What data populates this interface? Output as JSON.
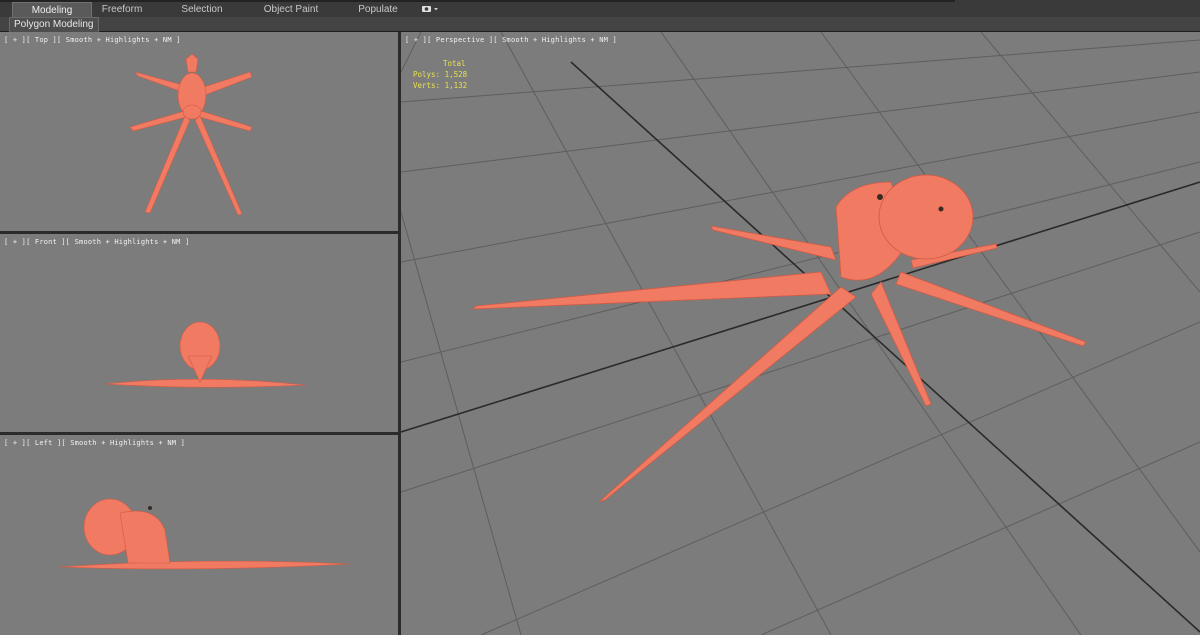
{
  "ribbon": {
    "tabs": [
      {
        "label": "Modeling",
        "active": true
      },
      {
        "label": "Freeform",
        "active": false
      },
      {
        "label": "Selection",
        "active": false
      },
      {
        "label": "Object Paint",
        "active": false
      },
      {
        "label": "Populate",
        "active": false
      }
    ],
    "extra_icon": "camera-dropdown-icon",
    "sub_tab": "Polygon Modeling"
  },
  "viewports": {
    "top": {
      "label": "[ + ][ Top ][ Smooth + Highlights + NM ]"
    },
    "front": {
      "label": "[ + ][ Front ][ Smooth + Highlights + NM ]"
    },
    "left": {
      "label": "[ + ][ Left ][ Smooth + Highlights + NM ]"
    },
    "perspective": {
      "label": "[ + ][ Perspective ][ Smooth + Highlights + NM ]",
      "stats": {
        "title": "Total",
        "polys": "Polys: 1,528",
        "verts": "Verts: 1,132"
      }
    }
  },
  "colors": {
    "viewport_bg": "#7c7c7c",
    "model": "#f07a62",
    "grid": "#3a3a3a",
    "stats_text": "#e8e24a"
  }
}
